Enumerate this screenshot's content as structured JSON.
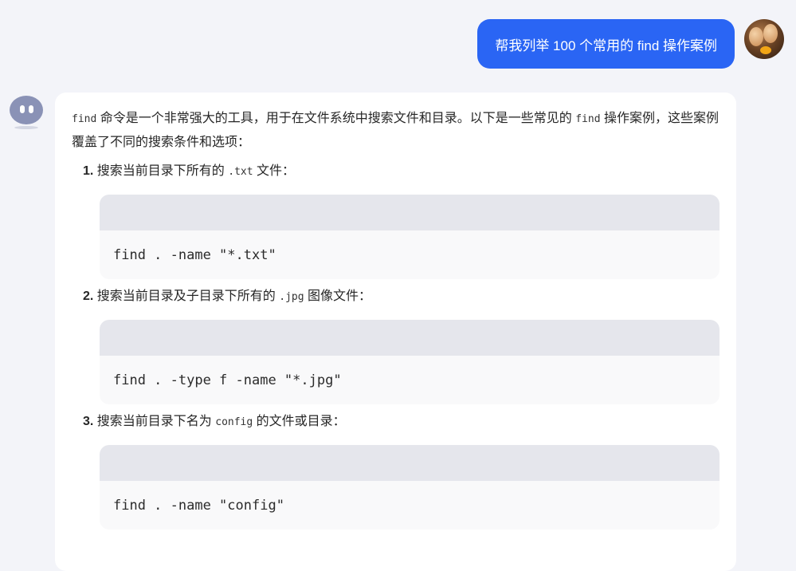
{
  "user_message": {
    "text": "帮我列举 100 个常用的 find 操作案例"
  },
  "assistant_message": {
    "intro_code": "find",
    "intro_text_1": " 命令是一个非常强大的工具，用于在文件系统中搜索文件和目录。以下是一些常见的 ",
    "intro_code_2": "find",
    "intro_text_2": " 操作案例，这些案例覆盖了不同的搜索条件和选项：",
    "items": [
      {
        "number": "1.",
        "text_before": " 搜索当前目录下所有的 ",
        "code": ".txt",
        "text_after": " 文件：",
        "command": "find . -name \"*.txt\""
      },
      {
        "number": "2.",
        "text_before": " 搜索当前目录及子目录下所有的 ",
        "code": ".jpg",
        "text_after": " 图像文件：",
        "command": "find . -type f -name \"*.jpg\""
      },
      {
        "number": "3.",
        "text_before": " 搜索当前目录下名为 ",
        "code": "config",
        "text_after": " 的文件或目录：",
        "command": "find . -name \"config\""
      }
    ]
  },
  "icons": {
    "user_avatar": "user-avatar-eggs",
    "assistant_avatar": "bot-avatar"
  },
  "colors": {
    "background": "#f3f4f9",
    "user_bubble": "#2a65f4",
    "card": "#ffffff",
    "code_header": "#e5e6ec",
    "code_body": "#f9f9fa",
    "bot_avatar": "#8a92b6"
  }
}
